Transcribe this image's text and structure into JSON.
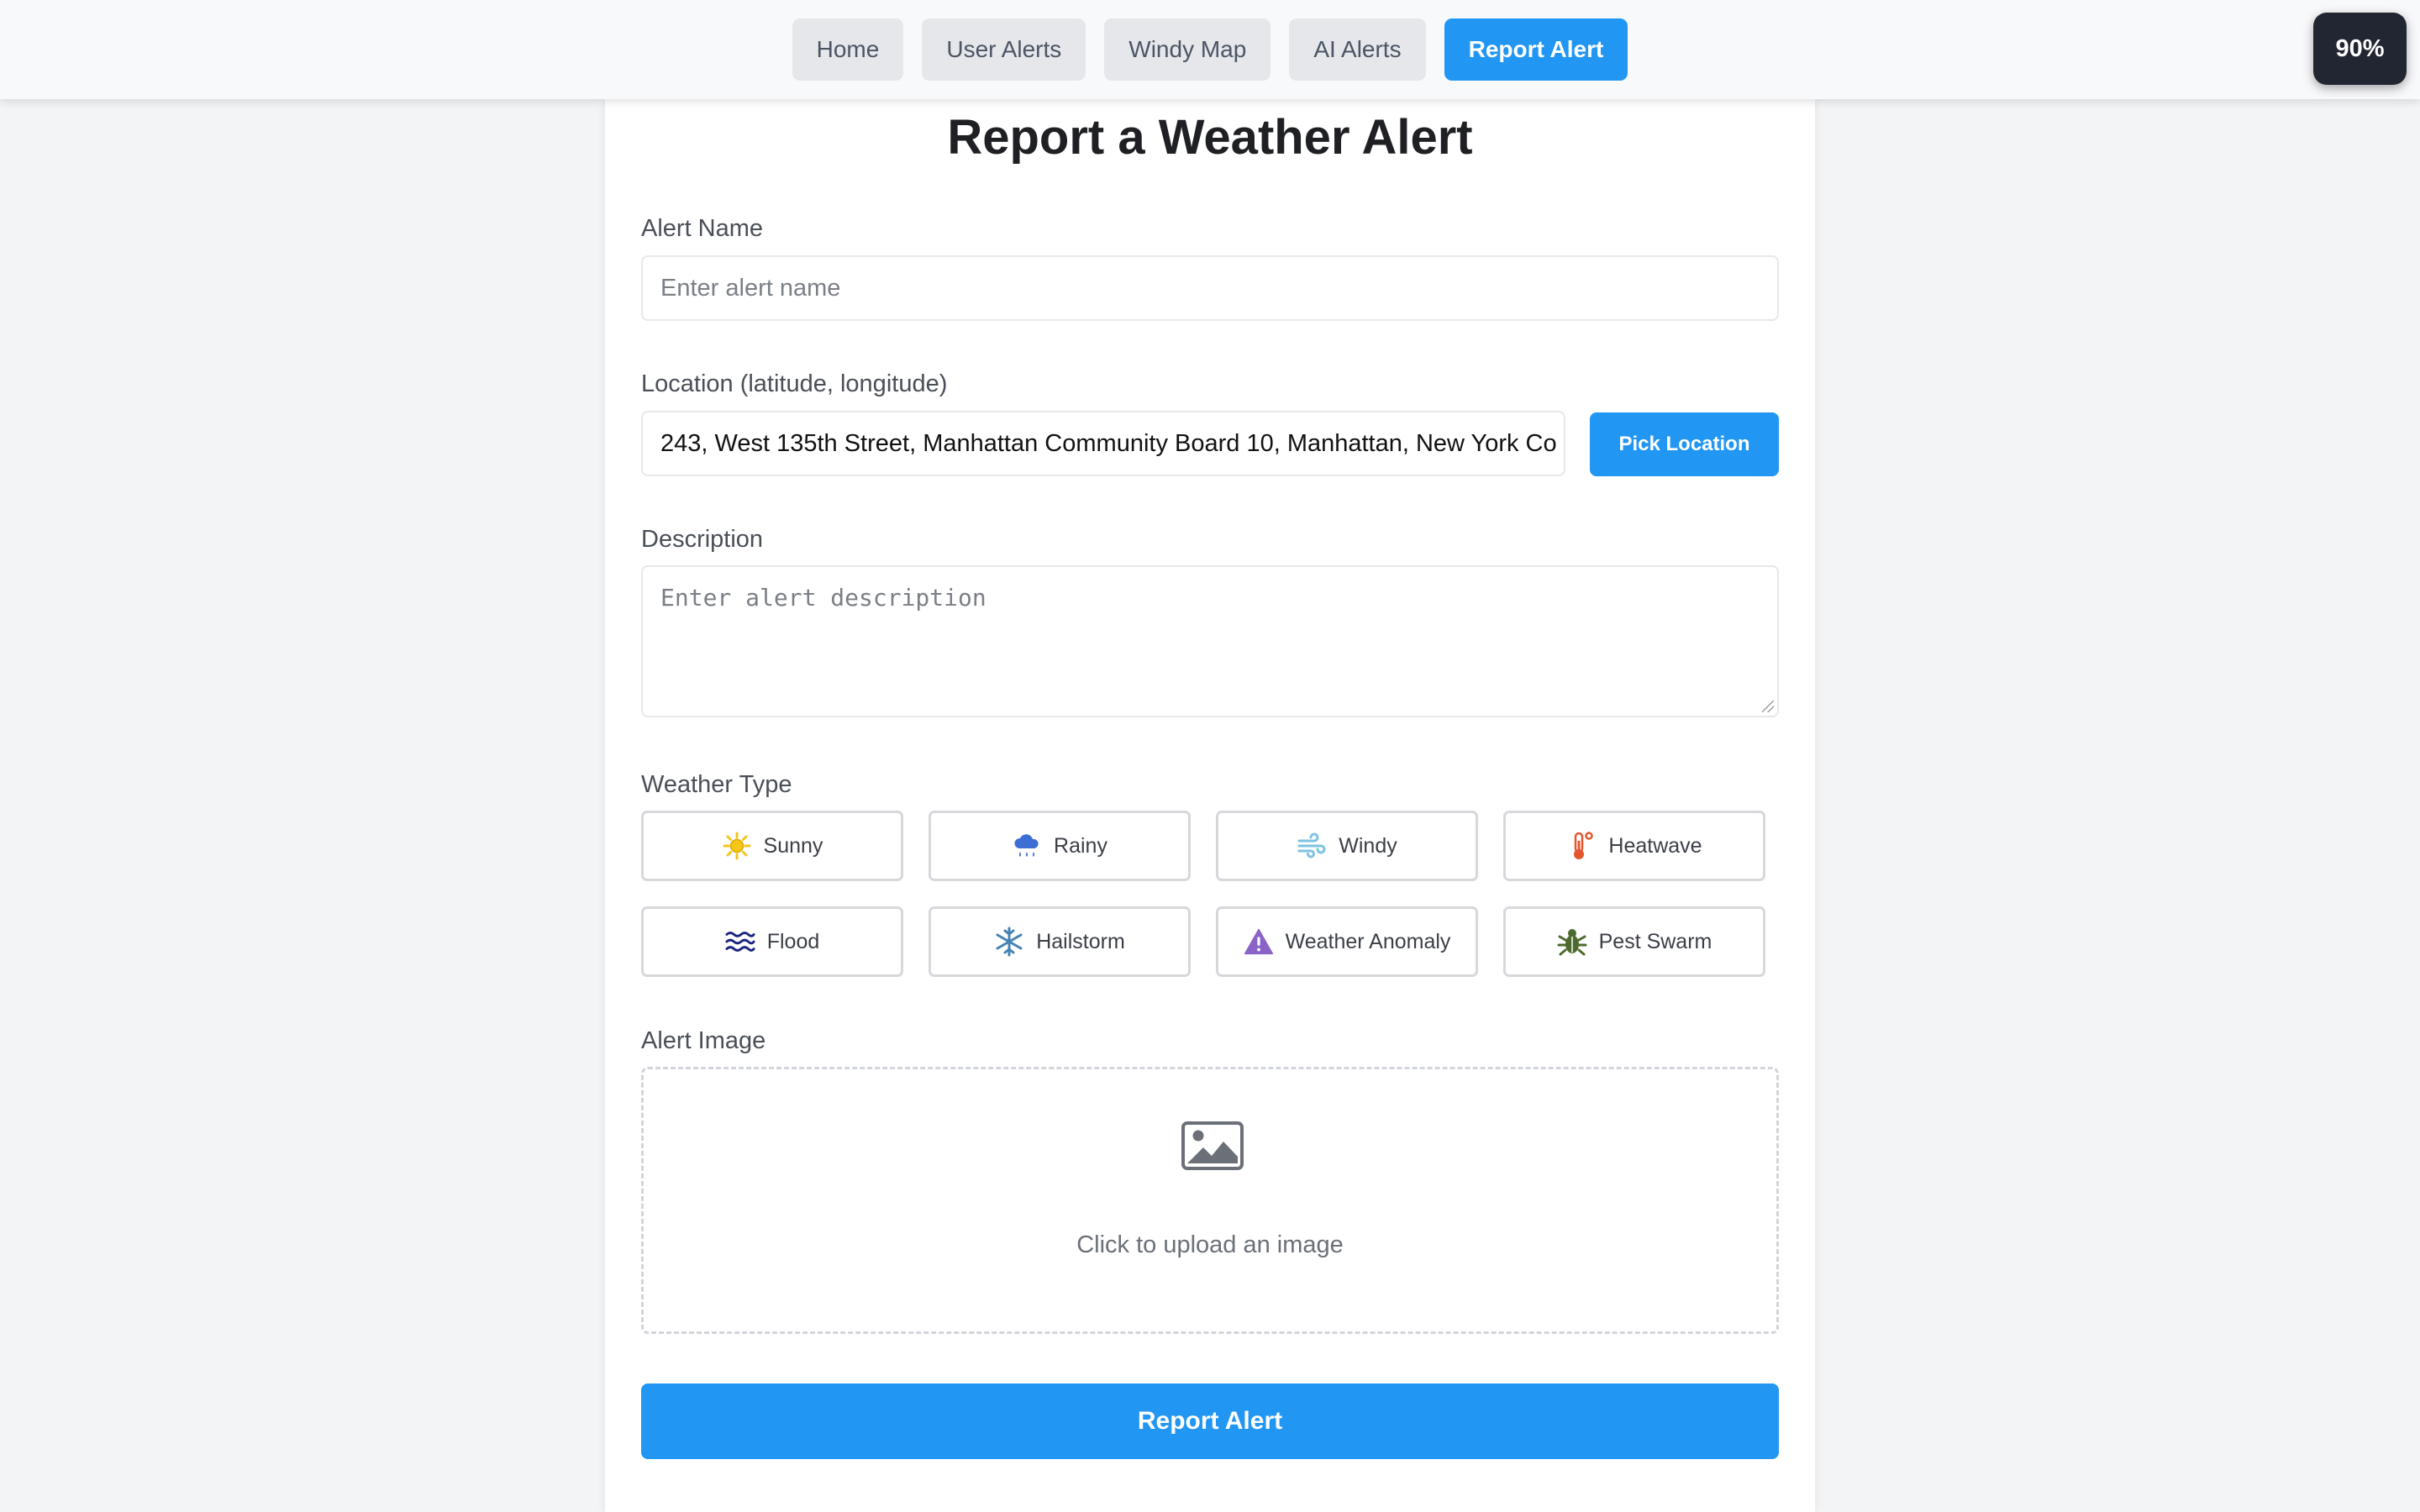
{
  "nav": {
    "items": [
      {
        "label": "Home"
      },
      {
        "label": "User Alerts"
      },
      {
        "label": "Windy Map"
      },
      {
        "label": "AI Alerts"
      },
      {
        "label": "Report Alert",
        "active": true
      }
    ]
  },
  "zoom": "90%",
  "page": {
    "title": "Report a Weather Alert"
  },
  "form": {
    "alert_name": {
      "label": "Alert Name",
      "placeholder": "Enter alert name",
      "value": ""
    },
    "location": {
      "label": "Location (latitude, longitude)",
      "value": "243, West 135th Street, Manhattan Community Board 10, Manhattan, New York Co",
      "pick_label": "Pick Location"
    },
    "description": {
      "label": "Description",
      "placeholder": "Enter alert description"
    },
    "weather_type": {
      "label": "Weather Type",
      "options": [
        {
          "label": "Sunny",
          "icon": "sun-icon"
        },
        {
          "label": "Rainy",
          "icon": "rain-cloud-icon"
        },
        {
          "label": "Windy",
          "icon": "wind-icon"
        },
        {
          "label": "Heatwave",
          "icon": "thermometer-icon"
        },
        {
          "label": "Flood",
          "icon": "water-waves-icon"
        },
        {
          "label": "Hailstorm",
          "icon": "snowflake-icon"
        },
        {
          "label": "Weather Anomaly",
          "icon": "warning-triangle-icon"
        },
        {
          "label": "Pest Swarm",
          "icon": "bug-icon"
        }
      ]
    },
    "image": {
      "label": "Alert Image",
      "upload_text": "Click to upload an image",
      "icon": "image-icon"
    },
    "submit_label": "Report Alert"
  },
  "colors": {
    "accent": "#2196f3",
    "sunny": "#f5c518",
    "rainy": "#3b6fd4",
    "windy": "#7ec3e0",
    "heatwave": "#e4572e",
    "flood": "#1a237e",
    "hailstorm": "#4682b4",
    "anomaly": "#8a63c9",
    "pest": "#4d6b2f"
  }
}
